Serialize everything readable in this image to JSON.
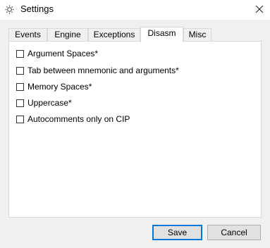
{
  "window": {
    "title": "Settings",
    "icon": "gear-icon",
    "close_icon": "close-icon"
  },
  "tabs": [
    {
      "label": "Events"
    },
    {
      "label": "Engine"
    },
    {
      "label": "Exceptions"
    },
    {
      "label": "Disasm",
      "active": true
    },
    {
      "label": "Misc"
    }
  ],
  "options": [
    {
      "label": "Argument Spaces*",
      "checked": false
    },
    {
      "label": "Tab between mnemonic and arguments*",
      "checked": false
    },
    {
      "label": "Memory Spaces*",
      "checked": false
    },
    {
      "label": "Uppercase*",
      "checked": false
    },
    {
      "label": "Autocomments only on CIP",
      "checked": false
    }
  ],
  "buttons": {
    "save_label": "Save",
    "cancel_label": "Cancel"
  },
  "colors": {
    "accent": "#0078d7",
    "panel_bg": "#ffffff",
    "window_bg": "#f0f0f0"
  }
}
